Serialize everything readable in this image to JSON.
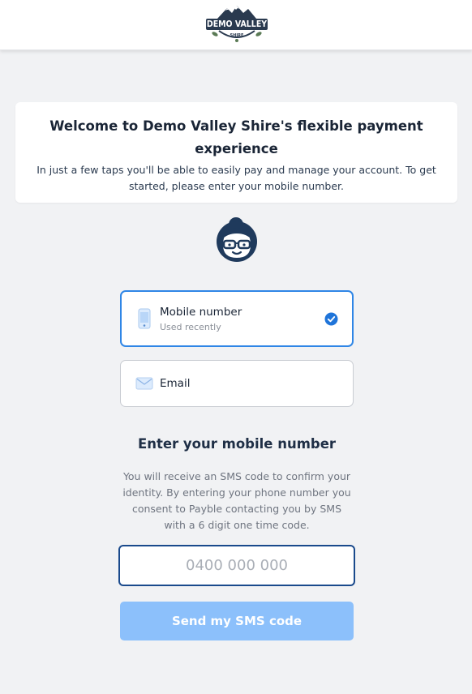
{
  "header": {
    "logo": {
      "text": "DEMO VALLEY",
      "subtext": "SHIRE"
    }
  },
  "welcome": {
    "title": "Welcome to Demo Valley Shire's flexible payment experience",
    "subtitle": "In just a few taps you'll be able to easily pay and manage your account. To get started, please enter your mobile number."
  },
  "avatar": {
    "icon": "woman-with-glasses-icon"
  },
  "options": [
    {
      "label": "Mobile number",
      "hint": "Used recently",
      "icon": "mobile-phone-icon",
      "selected": true
    },
    {
      "label": "Email",
      "icon": "envelope-icon",
      "selected": false
    }
  ],
  "form": {
    "title": "Enter your mobile number",
    "description": "You will receive an SMS code to confirm your identity. By entering your phone number you consent to Payble contacting you by SMS with a 6 digit one time code.",
    "phone_placeholder": "0400 000 000",
    "submit_label": "Send my SMS code"
  },
  "colors": {
    "accent": "#2f86e6",
    "button_disabled": "#8cc0fb",
    "navy": "#1f2f46",
    "background": "#f1f2f4"
  }
}
